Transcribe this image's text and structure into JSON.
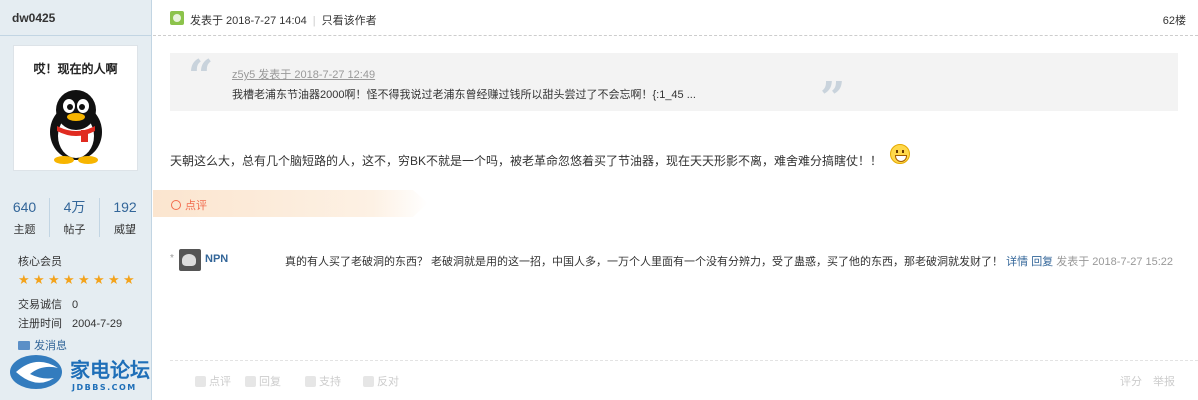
{
  "user": {
    "name": "dw0425",
    "avatar_caption": "哎！现在的人啊",
    "stats": [
      {
        "value": "640",
        "label": "主题"
      },
      {
        "value": "4万",
        "label": "帖子"
      },
      {
        "value": "192",
        "label": "威望"
      }
    ],
    "rank": "核心会员",
    "stars": 8,
    "trade_label": "交易诚信",
    "trade_value": "0",
    "reg_label": "注册时间",
    "reg_value": "2004-7-29",
    "send_msg": "发消息"
  },
  "post": {
    "posted": "发表于 2018-7-27 14:04",
    "only_author": "只看该作者",
    "floor": "62楼",
    "quote_author": "z5y5 发表于 2018-7-27 12:49",
    "quote_text": "我槽老浦东节油器2000啊！怪不得我说过老浦东曾经赚过钱所以甜头尝过了不会忘啊！{:1_45 ...",
    "content": "天朝这么大，总有几个脑短路的人，这不，穷BK不就是一个吗，被老革命忽悠着买了节油器，现在天天形影不离，难舍难分搞瞎仗！！",
    "comment_section": "点评",
    "comment": {
      "author": "NPN",
      "text": "真的有人买了老破洞的东西？ 老破洞就是用的这一招，中国人多，一万个人里面有一个没有分辨力，受了蛊惑，买了他的东西，那老破洞就发财了！",
      "detail": "详情",
      "reply": "回复",
      "time": "发表于 2018-7-27 15:22"
    },
    "footer": {
      "rate": "点评",
      "reply": "回复",
      "support": "支持",
      "oppose": "反对",
      "score": "评分",
      "report": "举报"
    }
  },
  "watermark": {
    "cn": "家电论坛",
    "en": "JDBBS.COM"
  },
  "colors": {
    "link": "#336699",
    "sidebar_bg": "#e5edf2",
    "comment_accent": "#f26c4f"
  }
}
